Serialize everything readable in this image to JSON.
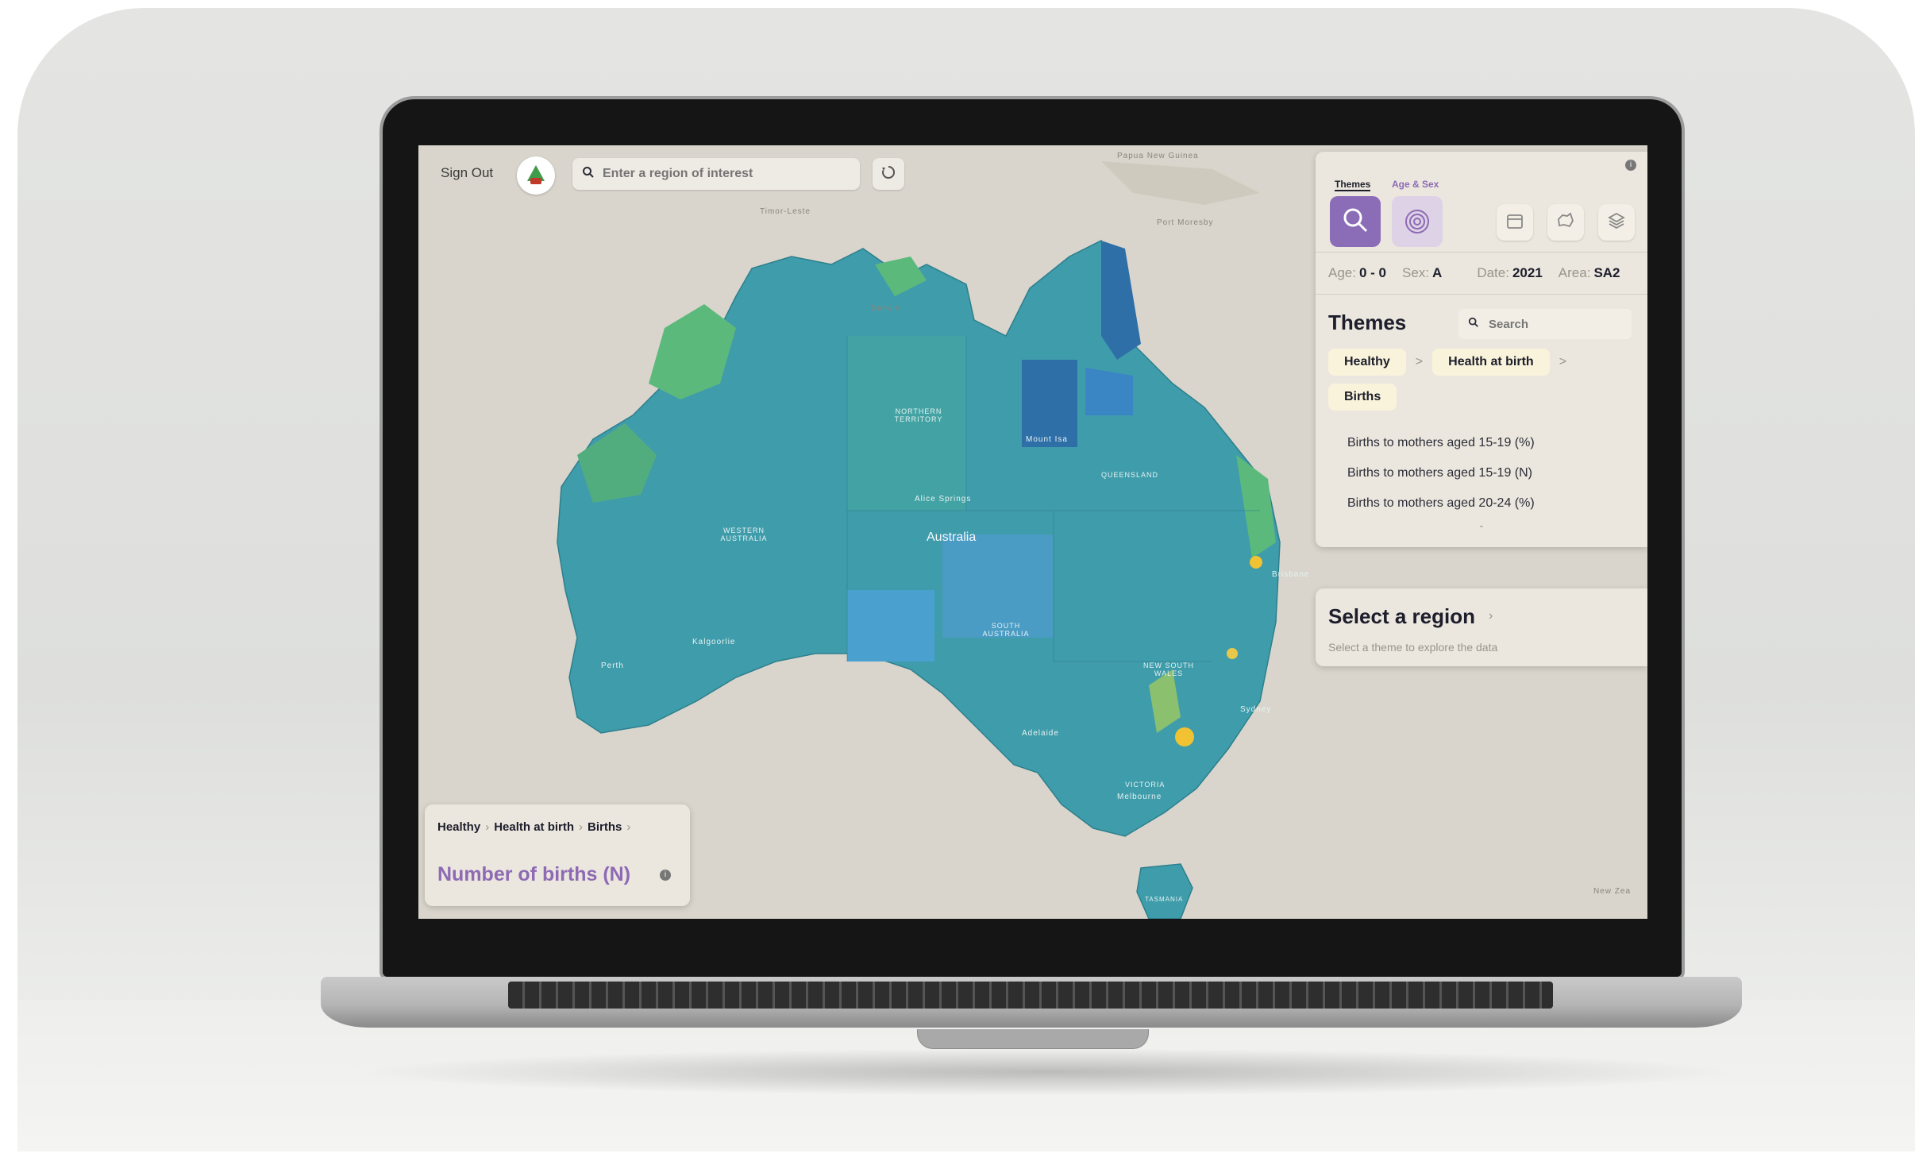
{
  "map": {
    "top_labels": [
      "Papua New Guinea",
      "Timor-Leste",
      "Port Moresby",
      "Darwin"
    ],
    "region_labels": {
      "northern_territory": "NORTHERN TERRITORY",
      "western_australia": "WESTERN AUSTRALIA",
      "south_australia": "SOUTH AUSTRALIA",
      "queensland": "QUEENSLAND",
      "new_south_wales": "NEW SOUTH WALES",
      "victoria": "VICTORIA",
      "tasmania": "TASMANIA",
      "country": "Australia"
    },
    "city_labels": [
      "Perth",
      "Adelaide",
      "Melbourne",
      "Sydney",
      "Brisbane",
      "Alice Springs",
      "Mount Isa",
      "Kalgoorlie"
    ],
    "corner_label": "New Zea"
  },
  "header": {
    "sign_out": "Sign Out",
    "search_placeholder": "Enter a region of interest"
  },
  "panel": {
    "tabs": [
      "Themes",
      "Age & Sex"
    ],
    "status": {
      "age_label": "Age:",
      "age_value": "0 - 0",
      "sex_label": "Sex:",
      "sex_value": "A",
      "date_label": "Date:",
      "date_value": "2021",
      "area_label": "Area:",
      "area_value": "SA2"
    },
    "themes_title": "Themes",
    "search_placeholder": "Search",
    "chips": [
      "Healthy",
      "Health at birth",
      "Births"
    ],
    "options": [
      "Births to mothers aged 15-19 (%)",
      "Births to mothers aged 15-19 (N)",
      "Births to mothers aged 20-24 (%)"
    ]
  },
  "region_card": {
    "title": "Select a region",
    "subtitle": "Select a theme to explore the data"
  },
  "legend": {
    "crumbs": [
      "Healthy",
      "Health at birth",
      "Births"
    ],
    "metric": "Number of births (N)"
  },
  "colors": {
    "accent_purple": "#8d6ab3",
    "chip_bg": "#f8f3da",
    "map_base": "#3f9cab",
    "map_dark": "#2f6fa8",
    "map_green": "#5cb97c",
    "map_yellow": "#f1c232"
  },
  "icons": [
    "search-icon",
    "reset-icon",
    "theme-magnify-icon",
    "fingerprint-icon",
    "calendar-icon",
    "australia-map-icon",
    "layers-icon",
    "info-icon"
  ]
}
